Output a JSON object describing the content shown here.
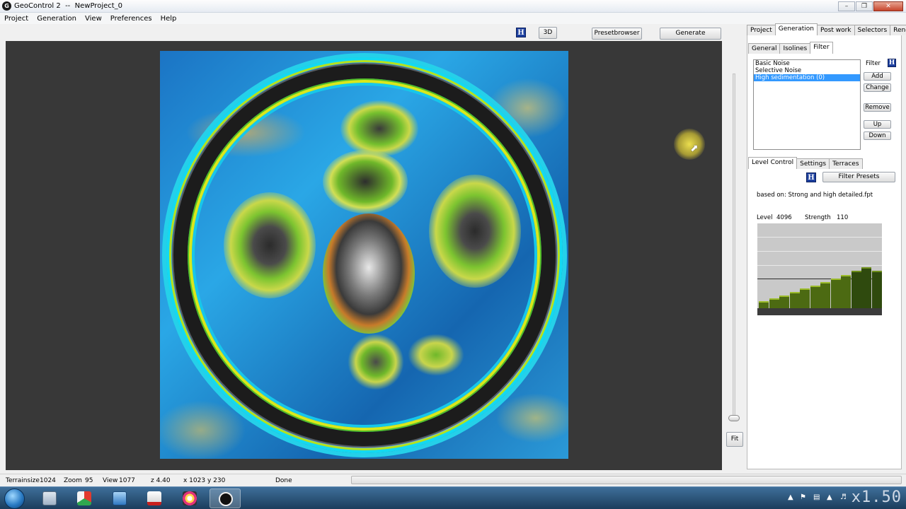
{
  "window": {
    "title": "GeoControl 2  --  NewProject_0",
    "app_logo": "G"
  },
  "menu": [
    "Project",
    "Generation",
    "View",
    "Preferences",
    "Help"
  ],
  "toolbar": {
    "help_label": "H",
    "three_d_label": "3D",
    "presetbrowser_label": "Presetbrowser",
    "generate_label": "Generate"
  },
  "view": {
    "fit_label": "Fit",
    "zoom_level": 0.02
  },
  "panel": {
    "main_tabs": [
      "Project",
      "Generation",
      "Post work",
      "Selectors",
      "Render"
    ],
    "main_active": "Generation",
    "sub_tabs": [
      "General",
      "Isolines",
      "Filter"
    ],
    "sub_active": "Filter",
    "filter_label": "Filter",
    "filters": [
      "Basic Noise",
      "Selective Noise",
      "High sedimentation  (0)"
    ],
    "selected_filter": "High sedimentation  (0)",
    "buttons": {
      "add": "Add",
      "change": "Change",
      "remove": "Remove",
      "up": "Up",
      "down": "Down"
    },
    "detail_tabs": [
      "Level Control",
      "Settings",
      "Terraces"
    ],
    "detail_active": "Level Control",
    "filter_presets_label": "Filter Presets",
    "based_on": "based on: Strong and high detailed.fpt",
    "level_label": "Level",
    "level_value": "4096",
    "strength_label": "Strength",
    "strength_value": "110",
    "level_bars": [
      0.08,
      0.12,
      0.15,
      0.19,
      0.23,
      0.27,
      0.31,
      0.35,
      0.39,
      0.44,
      0.48,
      0.44
    ]
  },
  "status": {
    "terrainsize_label": "Terrainsize",
    "terrainsize_value": "1024",
    "zoom_label": "Zoom",
    "zoom_value": "95",
    "view_label": "View",
    "view_value": "1077",
    "z_value": "z 4.40",
    "coords": "x 1023 y 230",
    "state": "Done"
  },
  "taskbar": {
    "overlay": "x1.50"
  }
}
